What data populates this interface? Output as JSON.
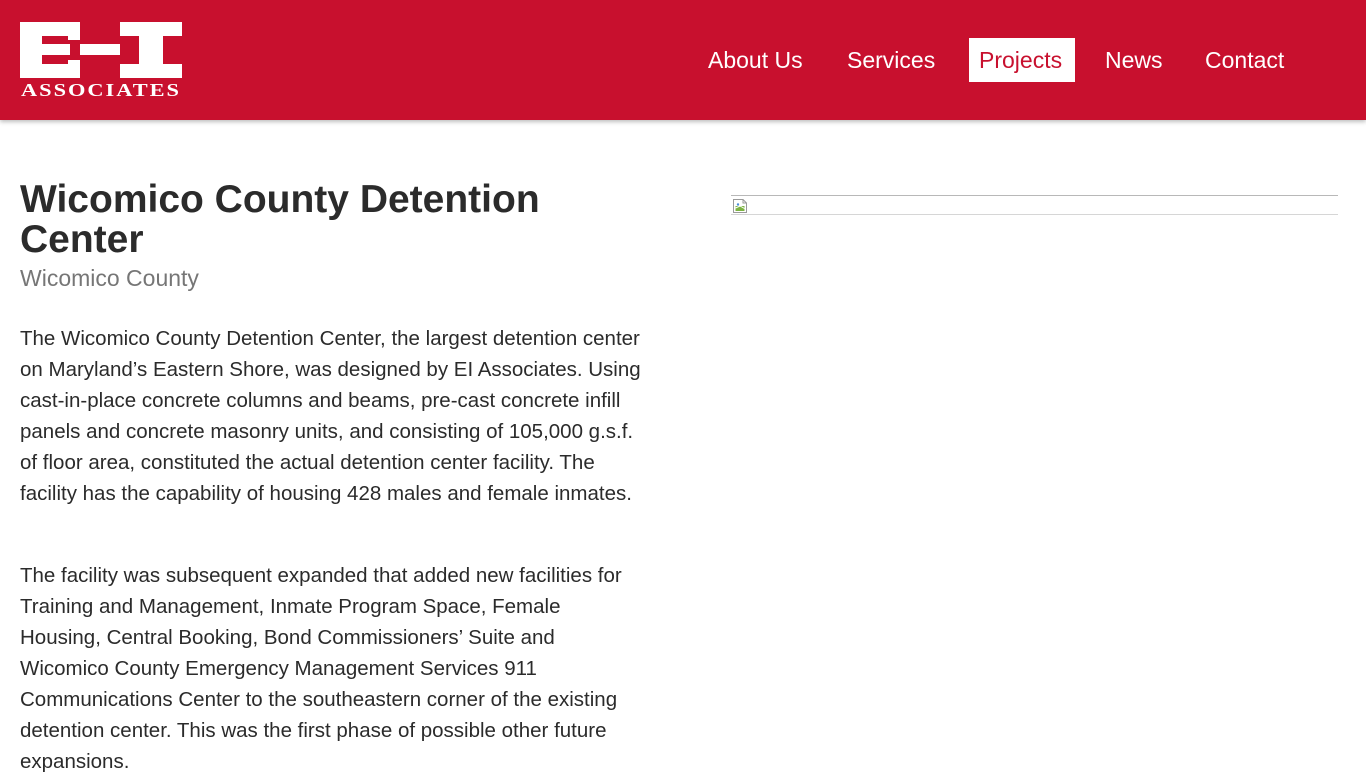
{
  "brand": {
    "logo_letters": "EI",
    "logo_subtitle": "ASSOCIATES",
    "color": "#c8102e"
  },
  "nav": {
    "items": [
      {
        "label": "About Us"
      },
      {
        "label": "Services"
      },
      {
        "label": "Projects",
        "active": true
      },
      {
        "label": "News"
      },
      {
        "label": "Contact"
      }
    ]
  },
  "project": {
    "title": "Wicomico County Detention Center",
    "location": "Wicomico County",
    "paragraphs": [
      "The Wicomico County Detention Center, the largest detention center on Maryland’s Eastern Shore, was designed by EI Associates. Using cast-in-place concrete columns and beams, pre-cast concrete infill panels and concrete masonry units, and consisting of 105,000 g.s.f. of floor area, constituted the actual detention center facility. The facility has the capability of housing 428 males and female inmates.",
      "The facility was subsequent expanded that added new facilities for Training and Management, Inmate Program Space, Female Housing, Central Booking, Bond Commissioners’ Suite and Wicomico County Emergency Management Services 911 Communications Center to the southeastern corner of the existing detention center. This was the first phase of possible other future expansions."
    ],
    "image_icon": "broken-image-icon"
  }
}
